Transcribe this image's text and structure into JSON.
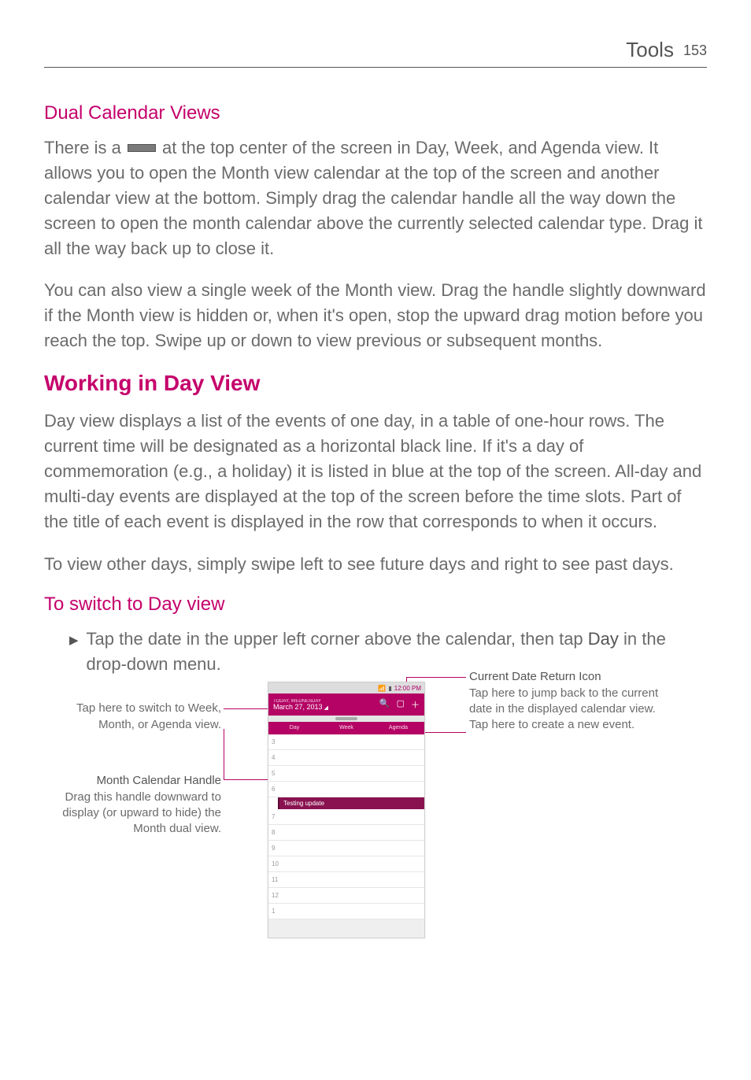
{
  "header": {
    "section": "Tools",
    "page": "153"
  },
  "h3_dual": "Dual Calendar Views",
  "p1a": "There is a ",
  "p1b": " at the top center of the screen in Day, Week, and Agenda view. It allows you to open the Month view calendar at the top of the screen and another calendar view at the bottom. Simply drag the calendar handle all the way down the screen to open the month calendar above the currently selected calendar type. Drag it all the way back up to close it.",
  "p2": "You can also view a single week of the Month view. Drag the handle slightly downward if the Month view is hidden or, when it's open, stop the upward drag motion before you reach the top. Swipe up or down to view previous or subsequent months.",
  "h2_working": "Working in Day View",
  "p3": "Day view displays a list of the events of one day, in a table of one-hour rows. The current time will be designated as a horizontal black line. If it's a day of commemoration (e.g., a holiday) it is listed in blue at the top of the screen. All-day and multi-day events are displayed at the top of the screen before the time slots. Part of the title of each event is displayed in the row that corresponds to when it occurs.",
  "p4": "To view other days, simply swipe left to see future days and right to see past days.",
  "h3_switch": "To switch to Day view",
  "bullet": {
    "pre": "Tap the date in the upper left corner above the calendar, then tap ",
    "bold": "Day",
    "post": " in the drop-down menu."
  },
  "callouts": {
    "left1": "Tap here to switch to Week, Month, or Agenda view.",
    "left2_label": "Month Calendar Handle",
    "left2_body": "Drag this handle downward to display (or upward to hide) the Month dual view.",
    "right_label": "Current Date Return Icon",
    "right_body1": "Tap here to jump back to the current date in the displayed calendar view.",
    "right_body2": "Tap here to create a new event."
  },
  "phone": {
    "time": "12:00 PM",
    "date_small": "TODAY, WEDNESDAY",
    "date": "March 27, 2013",
    "tabs": [
      "Day",
      "Week",
      "Agenda"
    ],
    "hours": [
      "3",
      "4",
      "5",
      "6",
      "7",
      "8",
      "9",
      "10",
      "11",
      "12",
      "1"
    ],
    "event": "Testing update"
  }
}
